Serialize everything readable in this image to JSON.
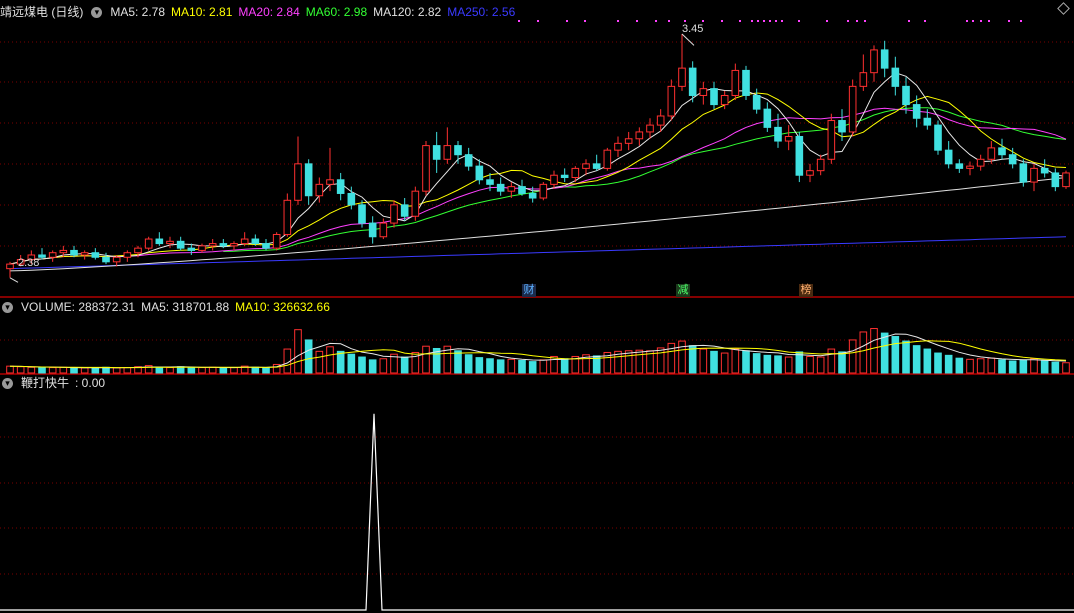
{
  "header_main": {
    "title": "靖远煤电 (日线)",
    "ma5": "MA5: 2.78",
    "ma10": "MA10: 2.81",
    "ma20": "MA20: 2.84",
    "ma60": "MA60: 2.98",
    "ma120": "MA120: 2.82",
    "ma250": "MA250: 2.56"
  },
  "header_volume": {
    "volume": "VOLUME: 288372.31",
    "ma5": "MA5: 318701.88",
    "ma10": "MA10: 326632.66"
  },
  "header_indicator": {
    "name": "鞭打快牛",
    "value": ": 0.00"
  },
  "badges": {
    "cai": "财",
    "jian": "减",
    "bang": "榜"
  },
  "price_labels": {
    "high": "3.45",
    "low": "2.38"
  },
  "colors": {
    "up": "#ff3030",
    "down": "#40e0e0",
    "ma5": "#e8e8e8",
    "ma10": "#ffff00",
    "ma20": "#ff40ff",
    "ma60": "#33ff33",
    "ma120": "#e0e0e0",
    "ma250": "#3a3aff",
    "grid": "#7a0000",
    "separator": "#b00000",
    "indicator": "#ffffff"
  },
  "chart_data": {
    "type": "candlestick",
    "price_ylim": [
      2.3,
      3.52
    ],
    "volume_ylim": [
      0,
      1000000
    ],
    "indicator_ylim": [
      0,
      100
    ],
    "high_point": 3.45,
    "low_point": 2.38,
    "ma_last": {
      "ma5": 2.78,
      "ma10": 2.81,
      "ma20": 2.84,
      "ma60": 2.98,
      "ma120": 2.82,
      "ma250": 2.56
    },
    "candles": [
      [
        2.42,
        2.45,
        2.38,
        2.44
      ],
      [
        2.44,
        2.48,
        2.43,
        2.46
      ],
      [
        2.46,
        2.5,
        2.44,
        2.48
      ],
      [
        2.48,
        2.51,
        2.46,
        2.47
      ],
      [
        2.47,
        2.5,
        2.45,
        2.49
      ],
      [
        2.49,
        2.52,
        2.47,
        2.5
      ],
      [
        2.5,
        2.52,
        2.47,
        2.48
      ],
      [
        2.48,
        2.5,
        2.46,
        2.49
      ],
      [
        2.49,
        2.51,
        2.46,
        2.47
      ],
      [
        2.47,
        2.49,
        2.44,
        2.45
      ],
      [
        2.45,
        2.48,
        2.43,
        2.47
      ],
      [
        2.47,
        2.5,
        2.45,
        2.49
      ],
      [
        2.49,
        2.52,
        2.47,
        2.51
      ],
      [
        2.51,
        2.56,
        2.5,
        2.55
      ],
      [
        2.55,
        2.58,
        2.52,
        2.53
      ],
      [
        2.53,
        2.56,
        2.51,
        2.54
      ],
      [
        2.54,
        2.56,
        2.5,
        2.51
      ],
      [
        2.51,
        2.53,
        2.48,
        2.5
      ],
      [
        2.5,
        2.53,
        2.49,
        2.52
      ],
      [
        2.52,
        2.55,
        2.5,
        2.53
      ],
      [
        2.53,
        2.55,
        2.51,
        2.52
      ],
      [
        2.52,
        2.54,
        2.5,
        2.53
      ],
      [
        2.53,
        2.58,
        2.52,
        2.55
      ],
      [
        2.55,
        2.57,
        2.52,
        2.53
      ],
      [
        2.53,
        2.55,
        2.5,
        2.51
      ],
      [
        2.51,
        2.58,
        2.5,
        2.57
      ],
      [
        2.57,
        2.75,
        2.56,
        2.72
      ],
      [
        2.72,
        3.0,
        2.7,
        2.88
      ],
      [
        2.88,
        2.9,
        2.7,
        2.74
      ],
      [
        2.74,
        2.82,
        2.71,
        2.79
      ],
      [
        2.79,
        2.95,
        2.76,
        2.81
      ],
      [
        2.81,
        2.84,
        2.72,
        2.75
      ],
      [
        2.75,
        2.78,
        2.68,
        2.7
      ],
      [
        2.7,
        2.72,
        2.6,
        2.62
      ],
      [
        2.62,
        2.65,
        2.53,
        2.56
      ],
      [
        2.56,
        2.64,
        2.55,
        2.62
      ],
      [
        2.62,
        2.72,
        2.6,
        2.7
      ],
      [
        2.7,
        2.73,
        2.63,
        2.65
      ],
      [
        2.65,
        2.78,
        2.63,
        2.76
      ],
      [
        2.76,
        2.98,
        2.74,
        2.96
      ],
      [
        2.96,
        3.02,
        2.84,
        2.9
      ],
      [
        2.9,
        3.04,
        2.88,
        2.96
      ],
      [
        2.96,
        2.98,
        2.88,
        2.92
      ],
      [
        2.92,
        2.95,
        2.85,
        2.87
      ],
      [
        2.87,
        2.9,
        2.79,
        2.81
      ],
      [
        2.81,
        2.84,
        2.76,
        2.79
      ],
      [
        2.79,
        2.82,
        2.74,
        2.76
      ],
      [
        2.76,
        2.8,
        2.73,
        2.78
      ],
      [
        2.78,
        2.81,
        2.74,
        2.75
      ],
      [
        2.75,
        2.78,
        2.71,
        2.73
      ],
      [
        2.73,
        2.8,
        2.72,
        2.79
      ],
      [
        2.79,
        2.85,
        2.77,
        2.83
      ],
      [
        2.83,
        2.86,
        2.8,
        2.82
      ],
      [
        2.82,
        2.87,
        2.8,
        2.86
      ],
      [
        2.86,
        2.9,
        2.83,
        2.88
      ],
      [
        2.88,
        2.92,
        2.85,
        2.86
      ],
      [
        2.86,
        2.95,
        2.85,
        2.94
      ],
      [
        2.94,
        3.0,
        2.91,
        2.97
      ],
      [
        2.97,
        3.02,
        2.94,
        2.99
      ],
      [
        2.99,
        3.04,
        2.96,
        3.02
      ],
      [
        3.02,
        3.08,
        2.99,
        3.05
      ],
      [
        3.05,
        3.12,
        3.02,
        3.09
      ],
      [
        3.09,
        3.25,
        3.07,
        3.22
      ],
      [
        3.22,
        3.45,
        3.2,
        3.3
      ],
      [
        3.3,
        3.33,
        3.15,
        3.18
      ],
      [
        3.18,
        3.24,
        3.14,
        3.21
      ],
      [
        3.21,
        3.24,
        3.12,
        3.14
      ],
      [
        3.14,
        3.2,
        3.12,
        3.18
      ],
      [
        3.18,
        3.32,
        3.16,
        3.29
      ],
      [
        3.29,
        3.31,
        3.16,
        3.18
      ],
      [
        3.18,
        3.21,
        3.1,
        3.12
      ],
      [
        3.12,
        3.15,
        3.02,
        3.04
      ],
      [
        3.04,
        3.1,
        2.95,
        2.98
      ],
      [
        2.98,
        3.05,
        2.94,
        3.0
      ],
      [
        3.0,
        3.02,
        2.8,
        2.83
      ],
      [
        2.83,
        2.88,
        2.8,
        2.85
      ],
      [
        2.85,
        2.92,
        2.83,
        2.9
      ],
      [
        2.9,
        3.1,
        2.88,
        3.07
      ],
      [
        3.07,
        3.12,
        2.98,
        3.02
      ],
      [
        3.02,
        3.25,
        3.0,
        3.22
      ],
      [
        3.22,
        3.36,
        3.2,
        3.28
      ],
      [
        3.28,
        3.4,
        3.24,
        3.38
      ],
      [
        3.38,
        3.42,
        3.26,
        3.3
      ],
      [
        3.3,
        3.35,
        3.18,
        3.22
      ],
      [
        3.22,
        3.26,
        3.1,
        3.14
      ],
      [
        3.14,
        3.18,
        3.04,
        3.08
      ],
      [
        3.08,
        3.12,
        3.03,
        3.05
      ],
      [
        3.05,
        3.07,
        2.92,
        2.94
      ],
      [
        2.94,
        2.98,
        2.86,
        2.88
      ],
      [
        2.88,
        2.9,
        2.84,
        2.86
      ],
      [
        2.86,
        2.89,
        2.83,
        2.87
      ],
      [
        2.87,
        2.92,
        2.85,
        2.9
      ],
      [
        2.9,
        2.98,
        2.88,
        2.95
      ],
      [
        2.95,
        2.99,
        2.9,
        2.92
      ],
      [
        2.92,
        2.95,
        2.86,
        2.88
      ],
      [
        2.88,
        2.9,
        2.78,
        2.8
      ],
      [
        2.8,
        2.88,
        2.76,
        2.86
      ],
      [
        2.86,
        2.9,
        2.82,
        2.84
      ],
      [
        2.84,
        2.86,
        2.76,
        2.78
      ],
      [
        2.78,
        2.85,
        2.77,
        2.84
      ]
    ],
    "volumes": [
      120000,
      110000,
      100000,
      90000,
      95000,
      100000,
      85000,
      90000,
      95000,
      100000,
      90000,
      95000,
      110000,
      130000,
      100000,
      95000,
      110000,
      90000,
      95000,
      100000,
      90000,
      95000,
      120000,
      100000,
      90000,
      150000,
      420000,
      760000,
      580000,
      380000,
      460000,
      380000,
      330000,
      280000,
      230000,
      250000,
      330000,
      280000,
      360000,
      470000,
      430000,
      470000,
      390000,
      320000,
      270000,
      250000,
      230000,
      240000,
      220000,
      200000,
      230000,
      290000,
      250000,
      290000,
      320000,
      300000,
      360000,
      380000,
      390000,
      400000,
      390000,
      440000,
      520000,
      560000,
      480000,
      420000,
      380000,
      350000,
      420000,
      390000,
      340000,
      310000,
      300000,
      280000,
      370000,
      290000,
      280000,
      420000,
      370000,
      580000,
      720000,
      780000,
      700000,
      640000,
      560000,
      480000,
      420000,
      350000,
      310000,
      260000,
      240000,
      250000,
      260000,
      230000,
      210000,
      220000,
      250000,
      210000,
      190000,
      180000
    ],
    "indicator_x_index": 53,
    "indicator_peak": 90
  }
}
